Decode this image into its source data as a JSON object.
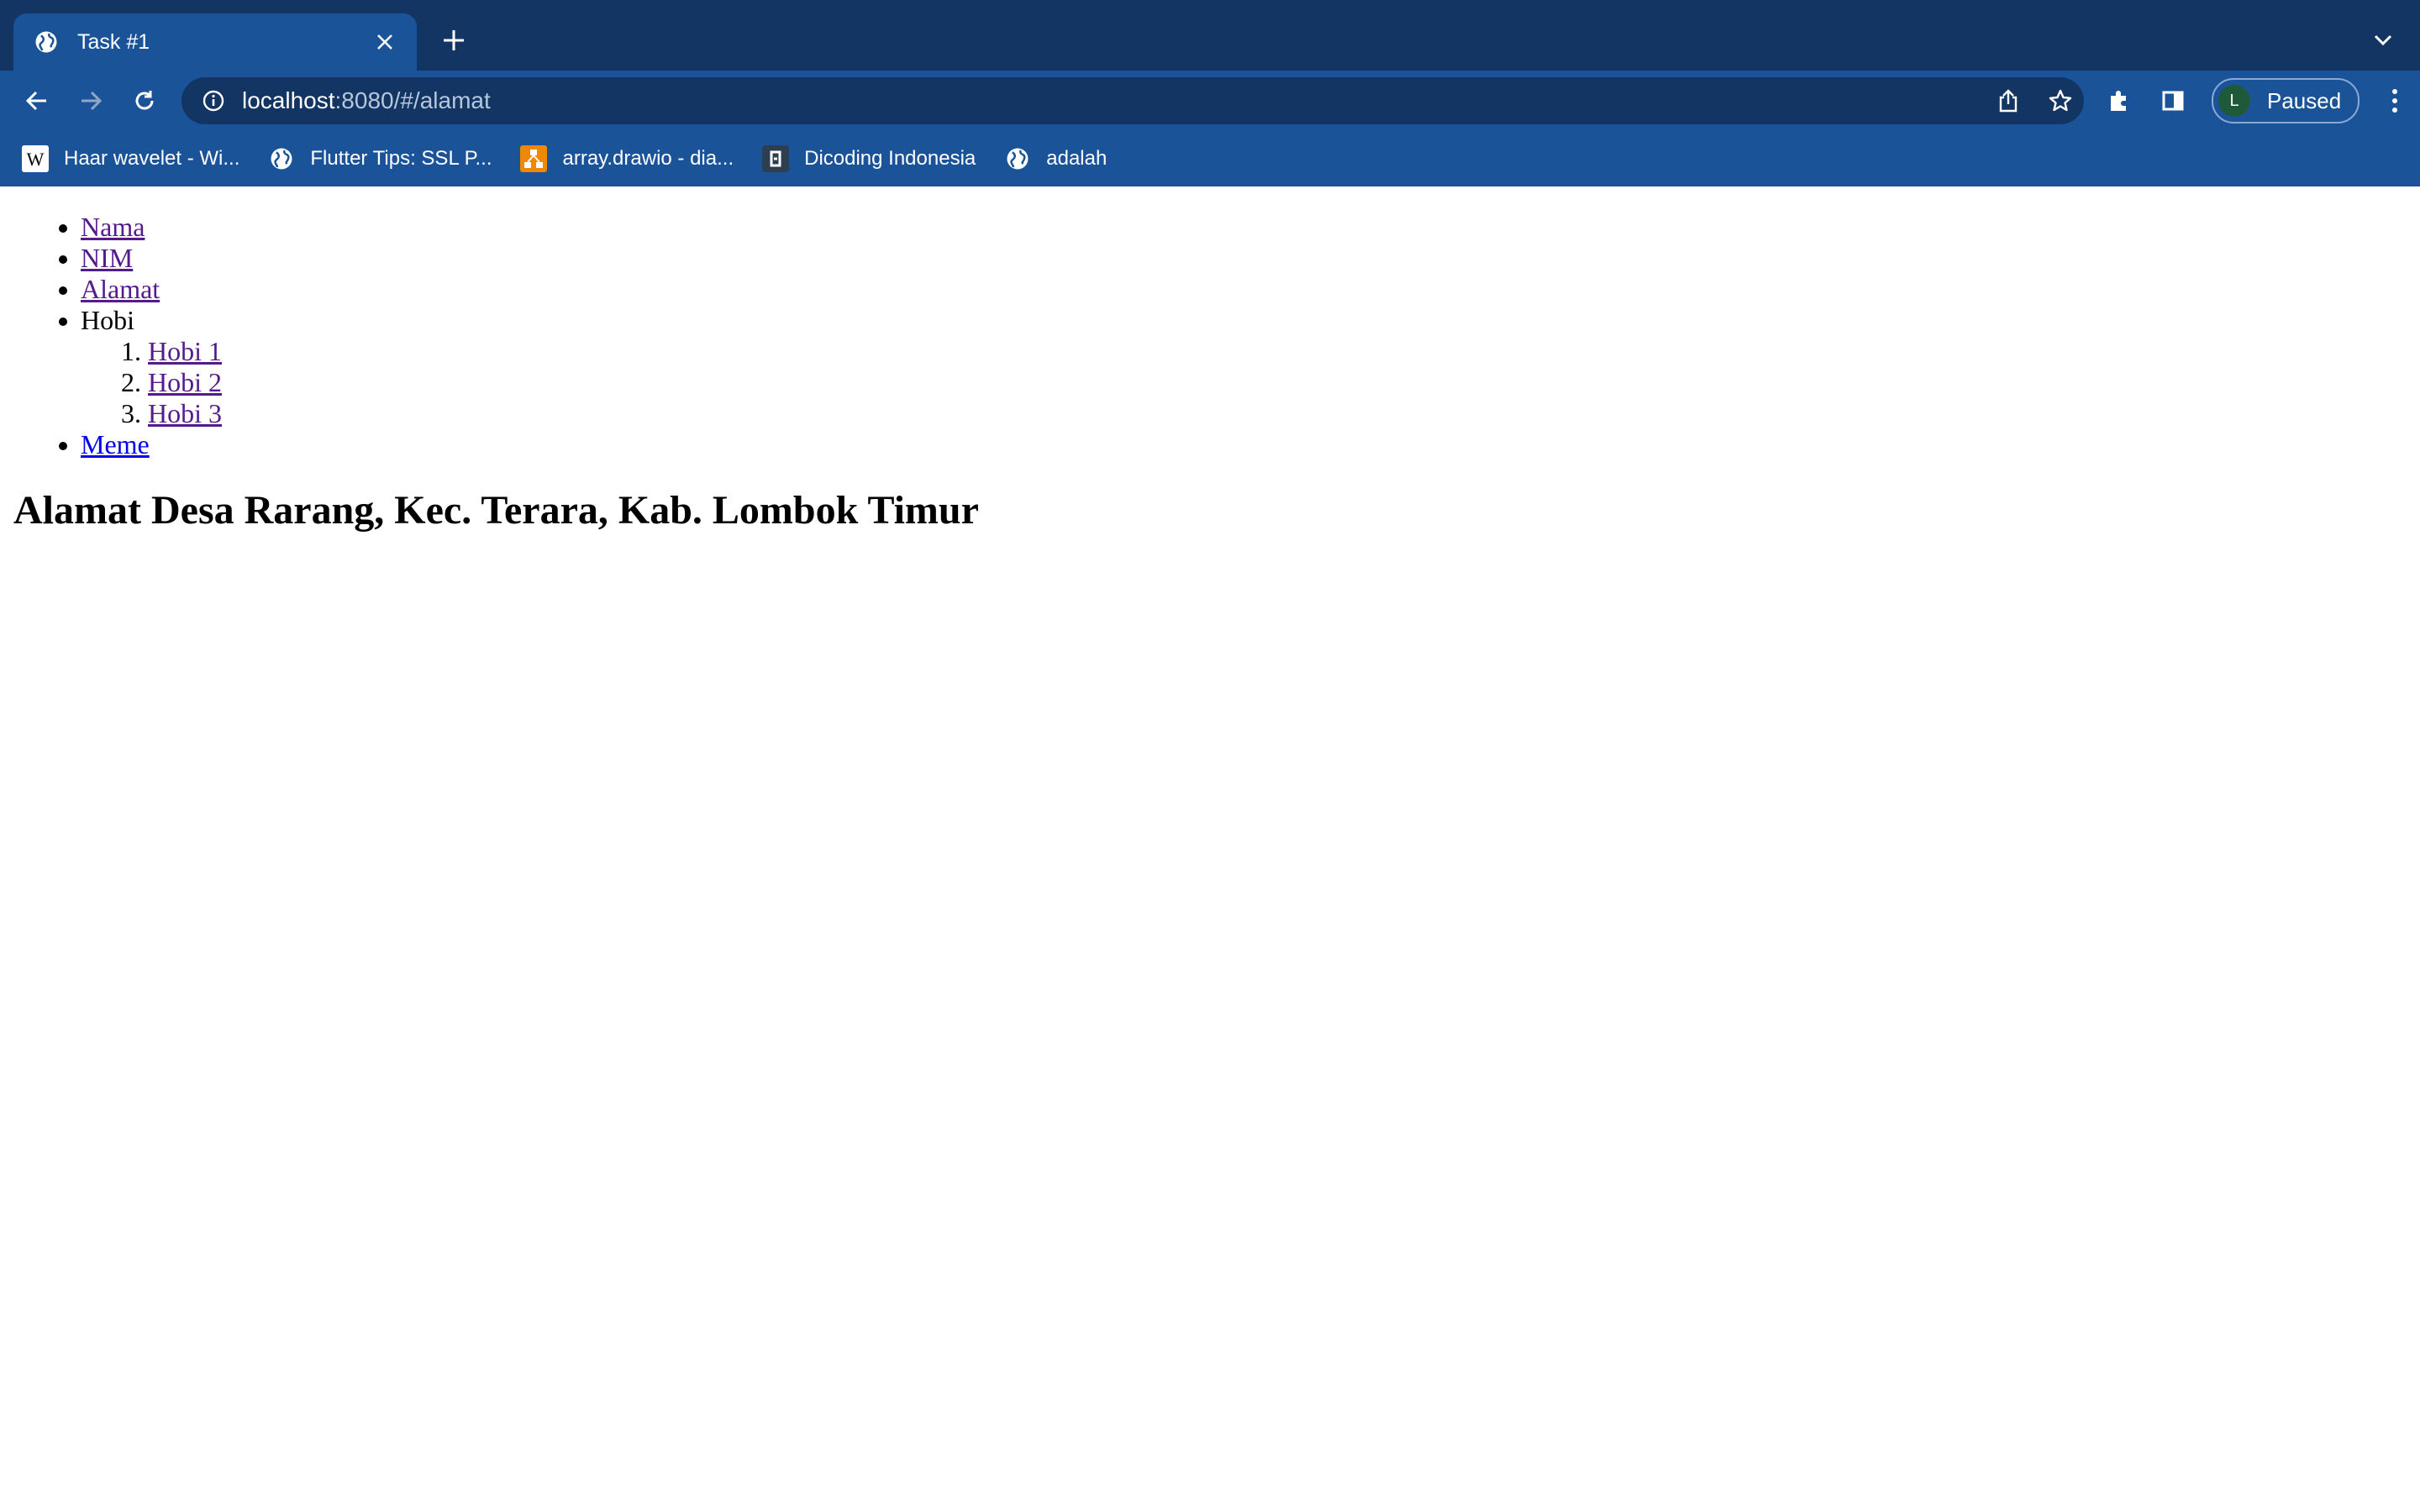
{
  "browser": {
    "tab": {
      "title": "Task #1"
    },
    "url": {
      "host": "localhost",
      "rest": ":8080/#/alamat"
    },
    "profile": {
      "initial": "L",
      "status": "Paused"
    },
    "bookmarks": [
      {
        "label": "Haar wavelet - Wi...",
        "icon": "wikipedia-icon"
      },
      {
        "label": "Flutter Tips: SSL P...",
        "icon": "globe-icon"
      },
      {
        "label": "array.drawio - dia...",
        "icon": "drawio-icon"
      },
      {
        "label": "Dicoding Indonesia",
        "icon": "dicoding-icon"
      },
      {
        "label": "adalah",
        "icon": "globe-icon"
      }
    ],
    "colors": {
      "tabstrip": "#133563",
      "toolbar": "#1b5399"
    }
  },
  "page": {
    "nav": {
      "items": [
        {
          "label": "Nama"
        },
        {
          "label": "NIM"
        },
        {
          "label": "Alamat"
        },
        {
          "label": "Hobi"
        },
        {
          "label": "Meme"
        }
      ],
      "hobbies": [
        {
          "label": "Hobi 1"
        },
        {
          "label": "Hobi 2"
        },
        {
          "label": "Hobi 3"
        }
      ]
    },
    "heading": "Alamat Desa Rarang, Kec. Terara, Kab. Lombok Timur"
  }
}
